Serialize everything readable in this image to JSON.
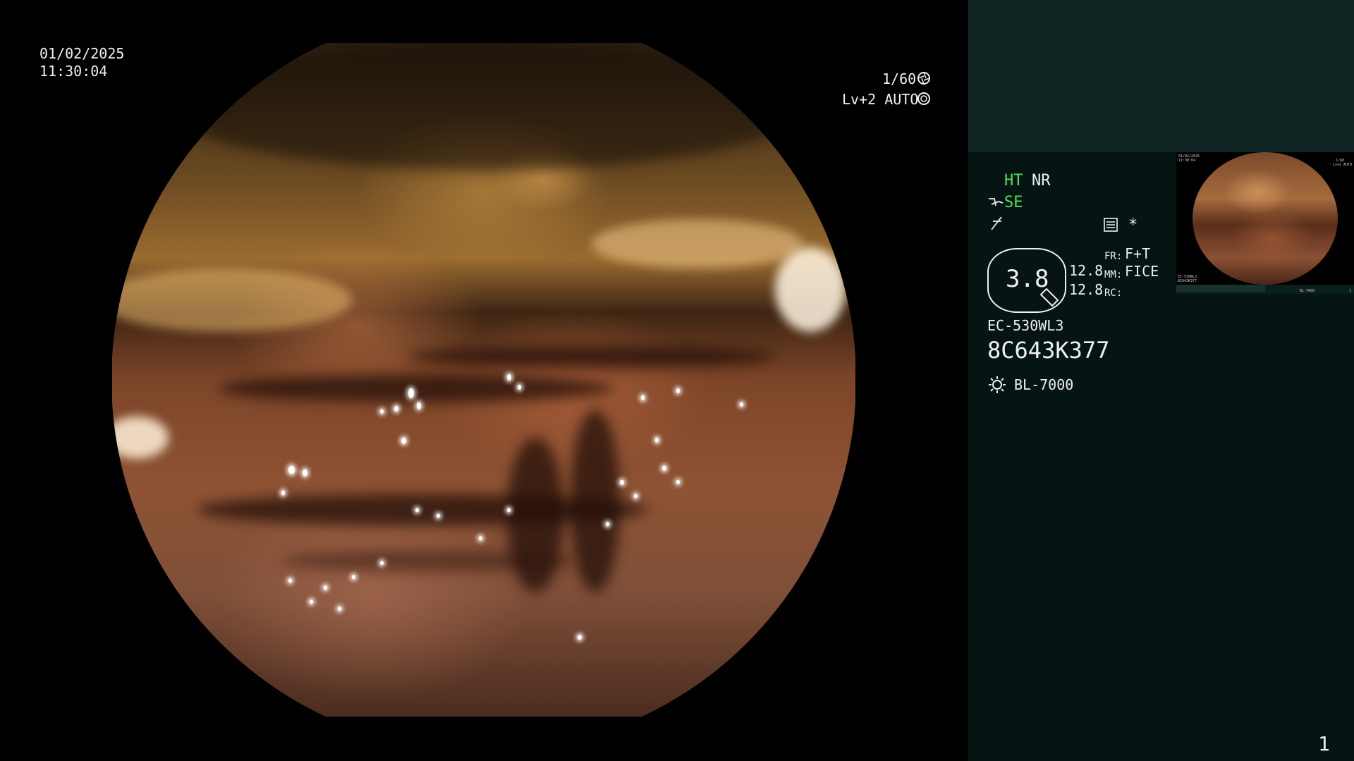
{
  "osd": {
    "date": "01/02/2025",
    "time": "11:30:04",
    "shutter": "1/60",
    "iris": "Lv+2 AUTO"
  },
  "status": {
    "ht": "HT",
    "nr": "NR",
    "se": "SE",
    "zoom": "3.8",
    "enh_a": "12.8",
    "enh_b": "12.8",
    "fr_label": "FR:",
    "fr_value": "F+T",
    "mm_label": "MM:",
    "mm_value": "FICE",
    "rc_label": "RC:",
    "asterisk": "*"
  },
  "scope": {
    "model": "EC-530WL3",
    "serial": "8C643K377",
    "light_source": "BL-7000"
  },
  "thumbnail": {
    "date": "01/02/2025",
    "time": "11:30:04",
    "shutter": "1/60",
    "iris": "Lv+2 AUTO",
    "model": "EC-530WL3",
    "serial": "8C643K377",
    "light_source": "BL-7000",
    "page": "1"
  },
  "page_number": "1",
  "icons": [
    "shutter-icon",
    "iris-icon",
    "scope-angle-icon",
    "fold-icon",
    "memo-icon",
    "zoom-lens-icon",
    "light-source-icon"
  ],
  "colors": {
    "accent_green": "#4ee05a",
    "panel_top": "#0f2523",
    "panel": "#061513"
  }
}
